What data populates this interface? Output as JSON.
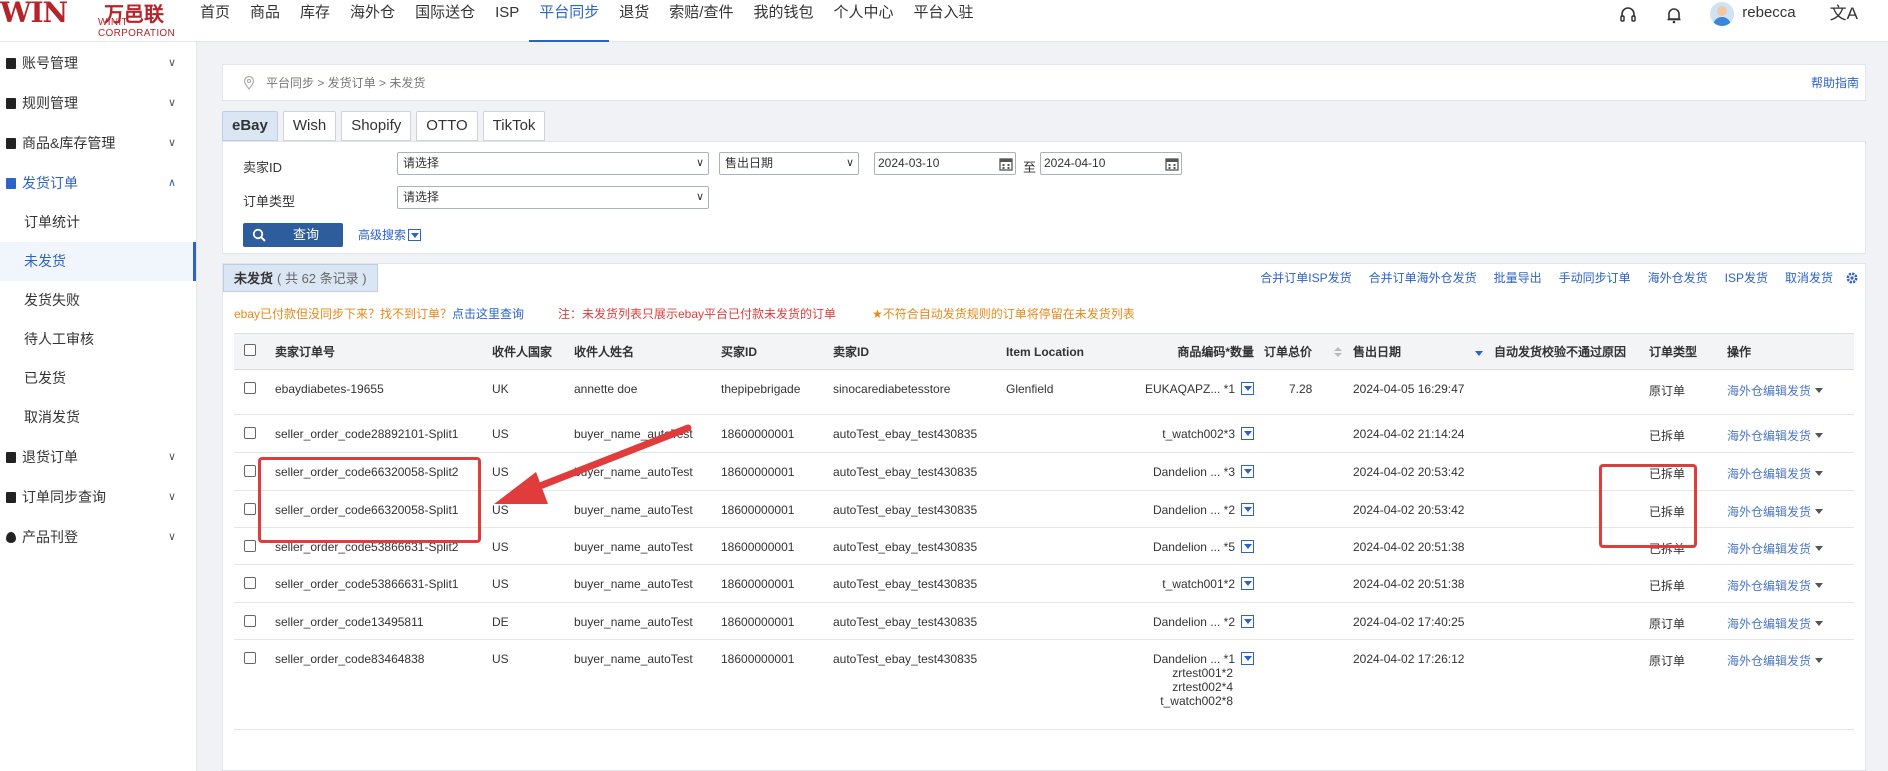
{
  "brand": {
    "logo_mark": "WIN",
    "logo_cn": "万邑联",
    "logo_en": "WINIT CORPORATION"
  },
  "nav": [
    {
      "label": "首页",
      "active": false
    },
    {
      "label": "商品",
      "active": false
    },
    {
      "label": "库存",
      "active": false
    },
    {
      "label": "海外仓",
      "active": false
    },
    {
      "label": "国际送仓",
      "active": false
    },
    {
      "label": "ISP",
      "active": false
    },
    {
      "label": "平台同步",
      "active": true
    },
    {
      "label": "退货",
      "active": false
    },
    {
      "label": "索赔/查件",
      "active": false
    },
    {
      "label": "我的钱包",
      "active": false
    },
    {
      "label": "个人中心",
      "active": false
    },
    {
      "label": "平台入驻",
      "active": false
    }
  ],
  "user": {
    "name": "rebecca",
    "lang_glyph": "文A"
  },
  "sidebar": {
    "group_account": "账号管理",
    "group_rules": "规则管理",
    "group_goods": "商品&库存管理",
    "group_ship": "发货订单",
    "sub_stats": "订单统计",
    "sub_unshipped": "未发货",
    "sub_failed": "发货失败",
    "sub_manual": "待人工审核",
    "sub_shipped": "已发货",
    "sub_cancel": "取消发货",
    "group_return": "退货订单",
    "group_sync": "订单同步查询",
    "group_listing": "产品刊登"
  },
  "breadcrumb": {
    "path": "平台同步 > 发货订单 > 未发货",
    "help": "帮助指南"
  },
  "tabs": [
    "eBay",
    "Wish",
    "Shopify",
    "OTTO",
    "TikTok"
  ],
  "filter": {
    "seller_label": "卖家ID",
    "seller_value": "请选择",
    "date_type": "售出日期",
    "date_from": "2024-03-10",
    "date_to_label": "至",
    "date_to": "2024-04-10",
    "order_type_label": "订单类型",
    "order_type_value": "请选择",
    "query_btn": "查询",
    "advanced": "高级搜索"
  },
  "list": {
    "tab_label": "未发货",
    "count_text": "( 共 62 条记录 )",
    "actions": [
      "合并订单ISP发货",
      "合并订单海外仓发货",
      "批量导出",
      "手动同步订单",
      "海外仓发货",
      "ISP发货",
      "取消发货"
    ],
    "hint_left_a": "ebay已付款但没同步下来？找不到订单？",
    "hint_left_b": "点击这里查询",
    "hint_mid": "注：未发货列表只展示ebay平台已付款未发货的订单",
    "hint_right": "★不符合自动发货规则的订单将停留在未发货列表"
  },
  "columns": [
    "卖家订单号",
    "收件人国家",
    "收件人姓名",
    "买家ID",
    "卖家ID",
    "Item Location",
    "商品编码*数量",
    "订单总价",
    "售出日期",
    "自动发货校验不通过原因",
    "订单类型",
    "操作"
  ],
  "rows": [
    {
      "order": "ebaydiabetes-19655",
      "country": "UK",
      "name": "annette doe",
      "buyer": "thepipebrigade",
      "seller": "sinocarediabetesstore",
      "loc": "Glenfield",
      "sku": [
        "EUKAQAPZ... *1"
      ],
      "total": "7.28",
      "date": "2024-04-05 16:29:47",
      "type": "原订单",
      "op": "海外仓编辑发货"
    },
    {
      "order": "seller_order_code28892101-Split1",
      "country": "US",
      "name": "buyer_name_autoTest",
      "buyer": "18600000001",
      "seller": "autoTest_ebay_test430835",
      "loc": "",
      "sku": [
        "t_watch002*3"
      ],
      "total": "",
      "date": "2024-04-02 21:14:24",
      "type": "已拆单",
      "op": "海外仓编辑发货"
    },
    {
      "order": "seller_order_code66320058-Split2",
      "country": "US",
      "name": "buyer_name_autoTest",
      "buyer": "18600000001",
      "seller": "autoTest_ebay_test430835",
      "loc": "",
      "sku": [
        "Dandelion ... *3"
      ],
      "total": "",
      "date": "2024-04-02 20:53:42",
      "type": "已拆单",
      "op": "海外仓编辑发货"
    },
    {
      "order": "seller_order_code66320058-Split1",
      "country": "US",
      "name": "buyer_name_autoTest",
      "buyer": "18600000001",
      "seller": "autoTest_ebay_test430835",
      "loc": "",
      "sku": [
        "Dandelion ... *2"
      ],
      "total": "",
      "date": "2024-04-02 20:53:42",
      "type": "已拆单",
      "op": "海外仓编辑发货"
    },
    {
      "order": "seller_order_code53866631-Split2",
      "country": "US",
      "name": "buyer_name_autoTest",
      "buyer": "18600000001",
      "seller": "autoTest_ebay_test430835",
      "loc": "",
      "sku": [
        "Dandelion ... *5"
      ],
      "total": "",
      "date": "2024-04-02 20:51:38",
      "type": "已拆单",
      "op": "海外仓编辑发货"
    },
    {
      "order": "seller_order_code53866631-Split1",
      "country": "US",
      "name": "buyer_name_autoTest",
      "buyer": "18600000001",
      "seller": "autoTest_ebay_test430835",
      "loc": "",
      "sku": [
        "t_watch001*2"
      ],
      "total": "",
      "date": "2024-04-02 20:51:38",
      "type": "已拆单",
      "op": "海外仓编辑发货"
    },
    {
      "order": "seller_order_code13495811",
      "country": "DE",
      "name": "buyer_name_autoTest",
      "buyer": "18600000001",
      "seller": "autoTest_ebay_test430835",
      "loc": "",
      "sku": [
        "Dandelion ... *2"
      ],
      "total": "",
      "date": "2024-04-02 17:40:25",
      "type": "原订单",
      "op": "海外仓编辑发货"
    },
    {
      "order": "seller_order_code83464838",
      "country": "US",
      "name": "buyer_name_autoTest",
      "buyer": "18600000001",
      "seller": "autoTest_ebay_test430835",
      "loc": "",
      "sku": [
        "Dandelion ... *1",
        "zrtest001*2",
        "zrtest002*4",
        "t_watch002*8"
      ],
      "total": "",
      "date": "2024-04-02 17:26:12",
      "type": "原订单",
      "op": "海外仓编辑发货"
    }
  ],
  "colors": {
    "accent": "#2d63c8",
    "brand": "#b5242a",
    "annotation": "#e03c3c",
    "hint_orange": "#e8891c",
    "hint_red": "#e03c3c"
  }
}
